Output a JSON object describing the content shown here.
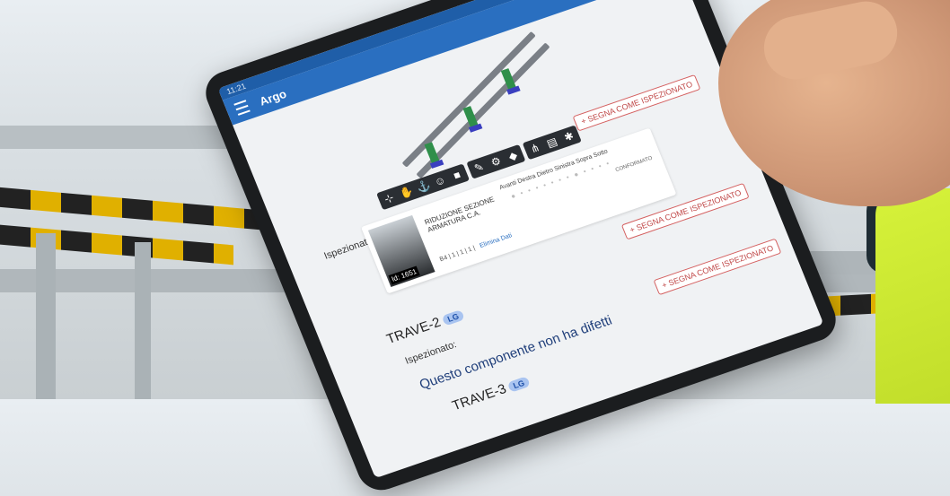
{
  "colors": {
    "app_bar": "#2a6fc0",
    "accent_red": "#c04848",
    "badge": "#a9c4f0"
  },
  "status_bar": {
    "time": "11:21"
  },
  "app": {
    "title": "Argo",
    "menu_icon": "hamburger-icon"
  },
  "toolbar": {
    "groups": [
      [
        "axis-icon",
        "hand-icon",
        "anchor-icon",
        "person-icon",
        "camera-icon"
      ],
      [
        "pencil-icon",
        "gear-add-icon",
        "cube-icon"
      ],
      [
        "hierarchy-icon",
        "layers-icon",
        "settings-icon"
      ]
    ]
  },
  "mark_label": "SEGNA COME ISPEZIONATO",
  "inspected_label": "Ispezionato:",
  "defect": {
    "name": "RIDUZIONE SEZIONE ARMATURA C.A.",
    "id": "Id: 1651",
    "columns": "Avanti  Destra   Dietro  Sinistra   Sopra  Sotto",
    "codes": "B4 | 1 | 1 | 1 |",
    "link": "Elimina Dati",
    "status": "CONFORMATO"
  },
  "components": [
    {
      "name": "TRAVE-2",
      "badge": "LG",
      "inspected": "Ispezionato:",
      "message": "Questo componente non ha difetti"
    },
    {
      "name": "TRAVE-3",
      "badge": "LG"
    }
  ]
}
